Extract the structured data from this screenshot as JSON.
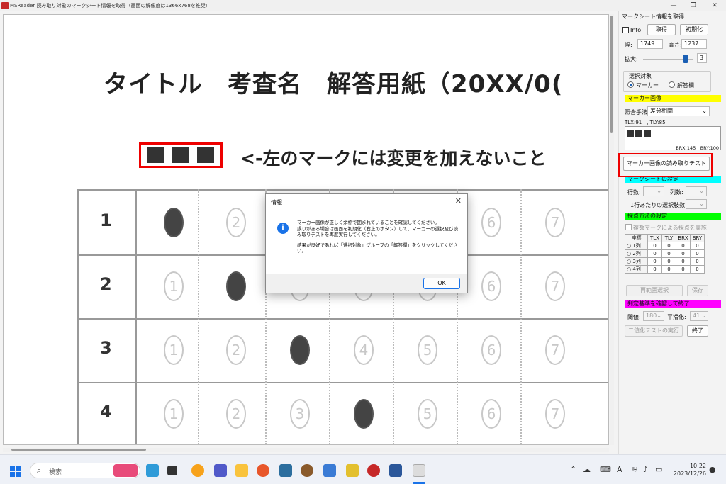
{
  "window": {
    "title": "MSReader 読み取り対象のマークシート情報を取得（画面の解像度は1366x768を推奨）",
    "minimize": "—",
    "restore": "❐",
    "close": "✕"
  },
  "sheet": {
    "title": "タイトル　考査名　解答用紙（20XX/0(",
    "note": "<-左のマークには変更を加えないこと",
    "rows": [
      {
        "num": "1",
        "filled": 1
      },
      {
        "num": "2",
        "filled": 2
      },
      {
        "num": "3",
        "filled": 3
      },
      {
        "num": "4",
        "filled": 4
      }
    ],
    "choices": [
      "1",
      "2",
      "3",
      "4",
      "5",
      "6",
      "7"
    ]
  },
  "panel": {
    "header": "マークシート情報を取得",
    "info_label": "Info",
    "get_button": "取得",
    "init_button": "初期化",
    "width_label": "幅:",
    "width_value": "1749",
    "height_label": "高さ:",
    "height_value": "1237",
    "zoom_label": "拡大:",
    "zoom_value": "3",
    "target_group": "選択対象",
    "target_marker": "マーカー",
    "target_answer": "解答欄",
    "marker_image_band": "マーカー画像",
    "match_label": "照合手法",
    "match_value": "差分相関",
    "tl_coords": "TLX:91　, TLY:85",
    "br_coords": "BRX:145　BRY:100",
    "read_test_button": "マーカー画像の読み取りテスト",
    "sheet_settings_band": "マークシートの設定",
    "rows_label": "行数:",
    "cols_label": "列数:",
    "choices_label": "1行あたりの選択肢数:",
    "scoring_band": "採点方法の設定",
    "multi_mark_label": "複数マークによる採点を実施",
    "coord_headers": [
      "座標",
      "TLX",
      "TLY",
      "BRX",
      "BRY"
    ],
    "coord_rows": [
      {
        "label": "1列",
        "vals": [
          "0",
          "0",
          "0",
          "0"
        ]
      },
      {
        "label": "2列",
        "vals": [
          "0",
          "0",
          "0",
          "0"
        ]
      },
      {
        "label": "3列",
        "vals": [
          "0",
          "0",
          "0",
          "0"
        ]
      },
      {
        "label": "4列",
        "vals": [
          "0",
          "0",
          "0",
          "0"
        ]
      }
    ],
    "reselect_button": "再範囲選択",
    "save_button": "保存",
    "criteria_band": "判定基準を確認して終了",
    "threshold_label": "閾値:",
    "threshold_value": "180",
    "smoothing_label": "平滑化:",
    "smoothing_value": "41",
    "binarize_button": "二値化テストの実行",
    "finish_button": "終了",
    "colors": {
      "yellow": "#ffff00",
      "cyan": "#00ffff",
      "green": "#00ff00",
      "magenta": "#ff00ff"
    }
  },
  "dialog": {
    "title": "情報",
    "close": "✕",
    "icon": "info-icon",
    "line1": "マーカー画像が正しく余枠で囲まれていることを確認してください。",
    "line2": "誤りがある場合は画面を初期化（右上のボタン）して、マーカーの選択及び読み取りテストを再度実行してください。",
    "line3": "結果が良好であれば「選択対象」グループの「解答欄」をクリックしてください。",
    "ok": "OK"
  },
  "taskbar": {
    "search_placeholder": "検索",
    "time": "10:22",
    "date": "2023/12/26",
    "ime": "A"
  }
}
